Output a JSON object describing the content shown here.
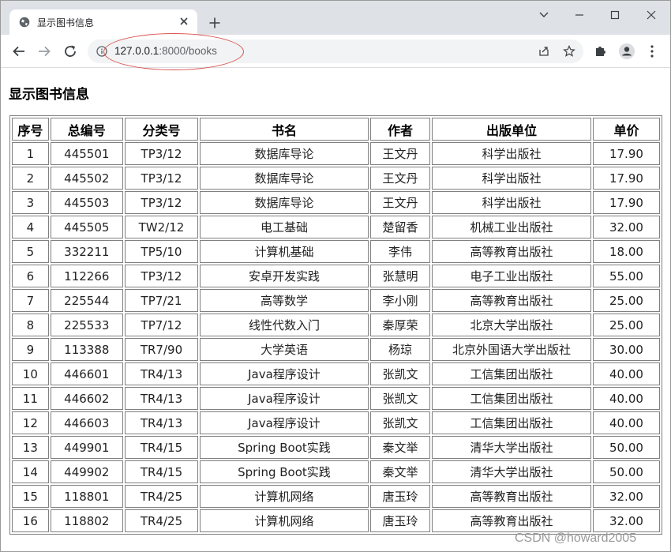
{
  "browser": {
    "tab_title": "显示图书信息",
    "url_host": "127.0.0.1",
    "url_rest": ":8000/books"
  },
  "page": {
    "heading": "显示图书信息",
    "columns": [
      "序号",
      "总编号",
      "分类号",
      "书名",
      "作者",
      "出版单位",
      "单价"
    ],
    "rows": [
      [
        "1",
        "445501",
        "TP3/12",
        "数据库导论",
        "王文丹",
        "科学出版社",
        "17.90"
      ],
      [
        "2",
        "445502",
        "TP3/12",
        "数据库导论",
        "王文丹",
        "科学出版社",
        "17.90"
      ],
      [
        "3",
        "445503",
        "TP3/12",
        "数据库导论",
        "王文丹",
        "科学出版社",
        "17.90"
      ],
      [
        "4",
        "445505",
        "TW2/12",
        "电工基础",
        "楚留香",
        "机械工业出版社",
        "32.00"
      ],
      [
        "5",
        "332211",
        "TP5/10",
        "计算机基础",
        "李伟",
        "高等教育出版社",
        "18.00"
      ],
      [
        "6",
        "112266",
        "TP3/12",
        "安卓开发实践",
        "张慧明",
        "电子工业出版社",
        "55.00"
      ],
      [
        "7",
        "225544",
        "TP7/21",
        "高等数学",
        "李小刚",
        "高等教育出版社",
        "25.00"
      ],
      [
        "8",
        "225533",
        "TP7/12",
        "线性代数入门",
        "秦厚荣",
        "北京大学出版社",
        "25.00"
      ],
      [
        "9",
        "113388",
        "TR7/90",
        "大学英语",
        "杨琼",
        "北京外国语大学出版社",
        "30.00"
      ],
      [
        "10",
        "446601",
        "TR4/13",
        "Java程序设计",
        "张凯文",
        "工信集团出版社",
        "40.00"
      ],
      [
        "11",
        "446602",
        "TR4/13",
        "Java程序设计",
        "张凯文",
        "工信集团出版社",
        "40.00"
      ],
      [
        "12",
        "446603",
        "TR4/13",
        "Java程序设计",
        "张凯文",
        "工信集团出版社",
        "40.00"
      ],
      [
        "13",
        "449901",
        "TR4/15",
        "Spring Boot实践",
        "秦文举",
        "清华大学出版社",
        "50.00"
      ],
      [
        "14",
        "449902",
        "TR4/15",
        "Spring Boot实践",
        "秦文举",
        "清华大学出版社",
        "50.00"
      ],
      [
        "15",
        "118801",
        "TR4/25",
        "计算机网络",
        "唐玉玲",
        "高等教育出版社",
        "32.00"
      ],
      [
        "16",
        "118802",
        "TR4/25",
        "计算机网络",
        "唐玉玲",
        "高等教育出版社",
        "32.00"
      ]
    ]
  },
  "watermark": "CSDN @howard2005"
}
